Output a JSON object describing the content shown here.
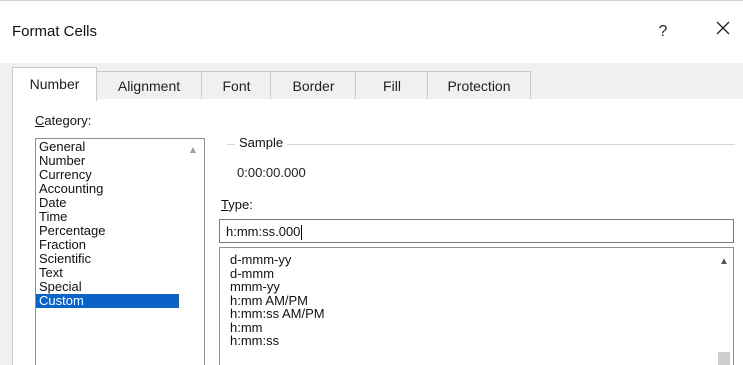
{
  "dialog": {
    "title": "Format Cells",
    "help_label": "?",
    "close_label": "✕"
  },
  "tabs": [
    {
      "label": "Number",
      "active": true
    },
    {
      "label": "Alignment",
      "active": false
    },
    {
      "label": "Font",
      "active": false
    },
    {
      "label": "Border",
      "active": false
    },
    {
      "label": "Fill",
      "active": false
    },
    {
      "label": "Protection",
      "active": false
    }
  ],
  "category": {
    "label_mnemonic": "C",
    "label_rest": "ategory:",
    "items": [
      "General",
      "Number",
      "Currency",
      "Accounting",
      "Date",
      "Time",
      "Percentage",
      "Fraction",
      "Scientific",
      "Text",
      "Special",
      "Custom"
    ],
    "selected": "Custom"
  },
  "sample": {
    "legend": "Sample",
    "value": "0:00:00.000"
  },
  "type": {
    "label_mnemonic": "T",
    "label_rest": "ype:",
    "input_value": "h:mm:ss.000",
    "items": [
      "d-mmm-yy",
      "d-mmm",
      "mmm-yy",
      "h:mm AM/PM",
      "h:mm:ss AM/PM",
      "h:mm",
      "h:mm:ss"
    ]
  },
  "icons": {
    "scroll_up": "▲"
  },
  "colors": {
    "selection": "#0a64c8",
    "dialog_bg": "#f0f0f0"
  }
}
